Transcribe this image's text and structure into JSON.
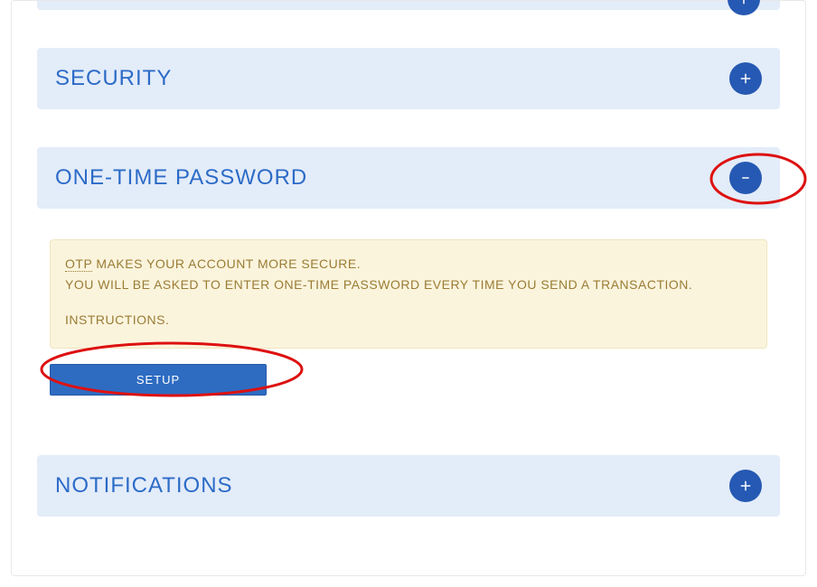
{
  "sections": {
    "security": {
      "title": "SECURITY"
    },
    "otp": {
      "title": "ONE-TIME PASSWORD",
      "info": {
        "abbr": "OTP",
        "line1_rest": " MAKES YOUR ACCOUNT MORE SECURE.",
        "line2": "YOU WILL BE ASKED TO ENTER ONE-TIME PASSWORD EVERY TIME YOU SEND A TRANSACTION.",
        "instructions": "INSTRUCTIONS",
        "period": "."
      },
      "setup_label": "SETUP"
    },
    "notifications": {
      "title": "NOTIFICATIONS"
    }
  }
}
